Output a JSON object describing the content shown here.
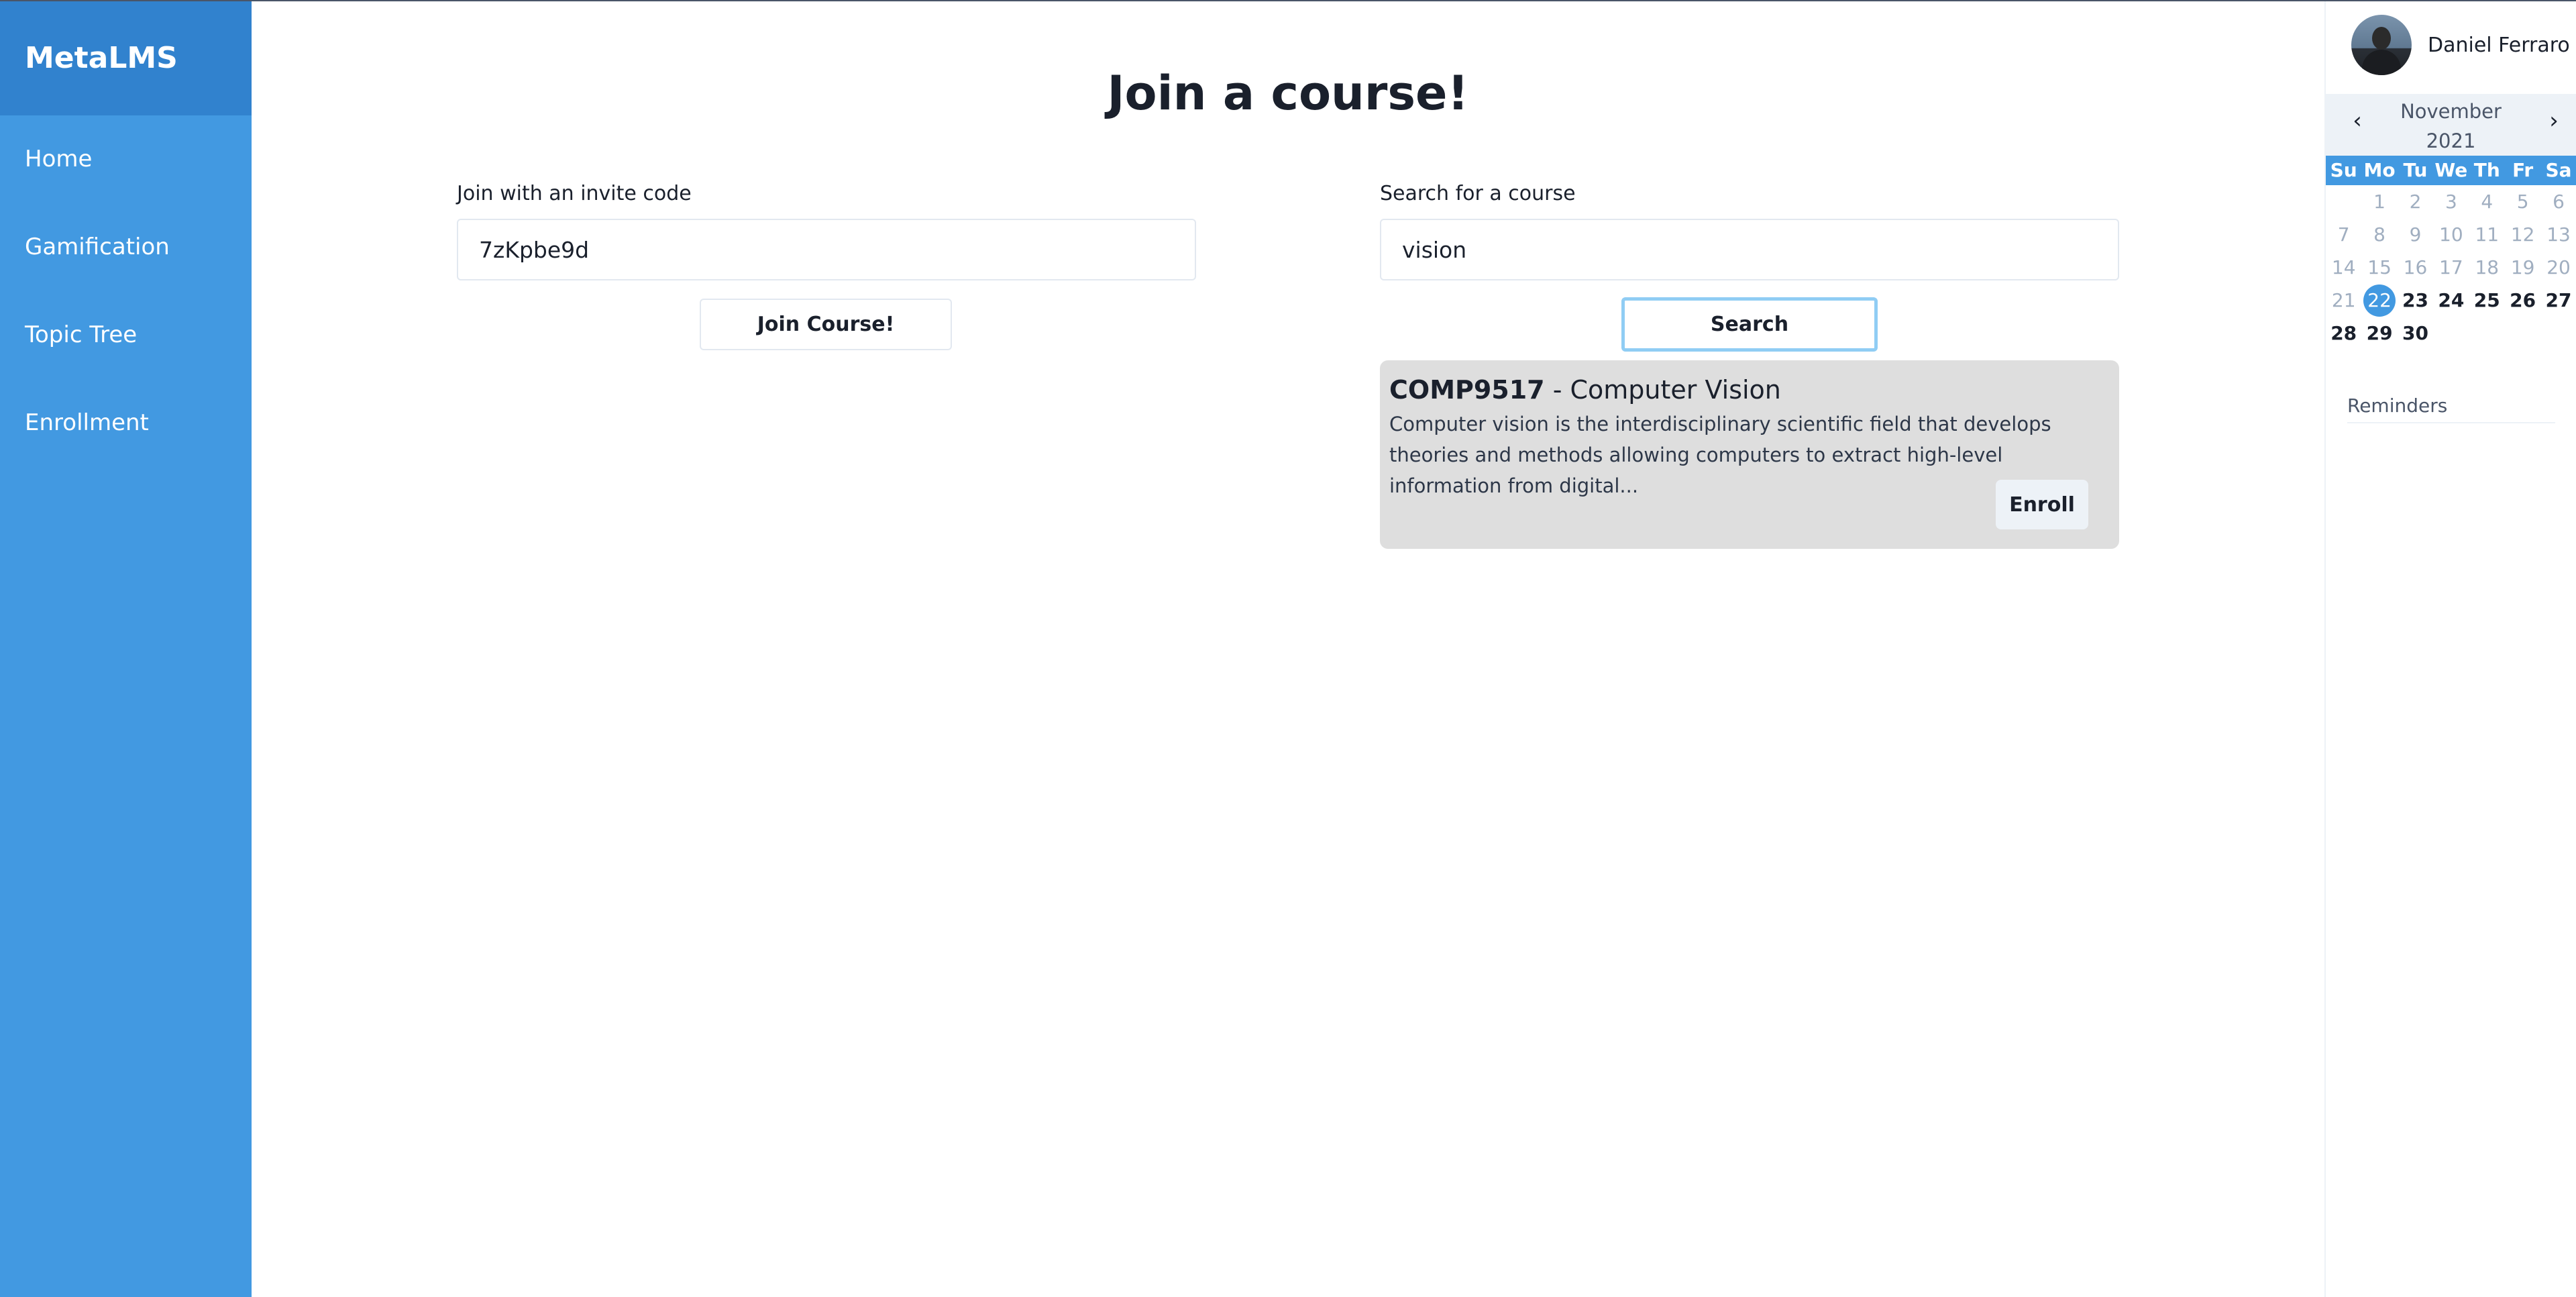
{
  "app": {
    "brand": "MetaLMS"
  },
  "sidebar": {
    "items": [
      {
        "label": "Home"
      },
      {
        "label": "Gamification"
      },
      {
        "label": "Topic Tree"
      },
      {
        "label": "Enrollment"
      }
    ]
  },
  "main": {
    "title": "Join a course!",
    "invite": {
      "label": "Join with an invite code",
      "value": "7zKpbe9d",
      "button_label": "Join Course!"
    },
    "search": {
      "label": "Search for a course",
      "value": "vision",
      "button_label": "Search"
    },
    "results": [
      {
        "code": "COMP9517",
        "separator": " - ",
        "name": "Computer Vision",
        "description": "Computer vision is the interdisciplinary scientific field that develops theories and methods allowing computers to extract high-level information from digital...",
        "enroll_label": "Enroll"
      }
    ]
  },
  "user": {
    "name": "Daniel Ferraro",
    "avatar_icon": "user-avatar-photo"
  },
  "calendar": {
    "month": "November",
    "year": "2021",
    "prev_icon": "chevron-left-icon",
    "next_icon": "chevron-right-icon",
    "prev_symbol": "‹",
    "next_symbol": "›",
    "weekdays": [
      "Su",
      "Mo",
      "Tu",
      "We",
      "Th",
      "Fr",
      "Sa"
    ],
    "weeks": [
      [
        "",
        "1",
        "2",
        "3",
        "4",
        "5",
        "6"
      ],
      [
        "7",
        "8",
        "9",
        "10",
        "11",
        "12",
        "13"
      ],
      [
        "14",
        "15",
        "16",
        "17",
        "18",
        "19",
        "20"
      ],
      [
        "21",
        "22",
        "23",
        "24",
        "25",
        "26",
        "27"
      ],
      [
        "28",
        "29",
        "30",
        "",
        "",
        "",
        ""
      ]
    ],
    "today": "22"
  },
  "reminders": {
    "label": "Reminders"
  },
  "colors": {
    "sidebar": "#4299e1",
    "brand_bg": "#3182ce",
    "accent": "#4299e1",
    "card_bg": "#dedede"
  }
}
